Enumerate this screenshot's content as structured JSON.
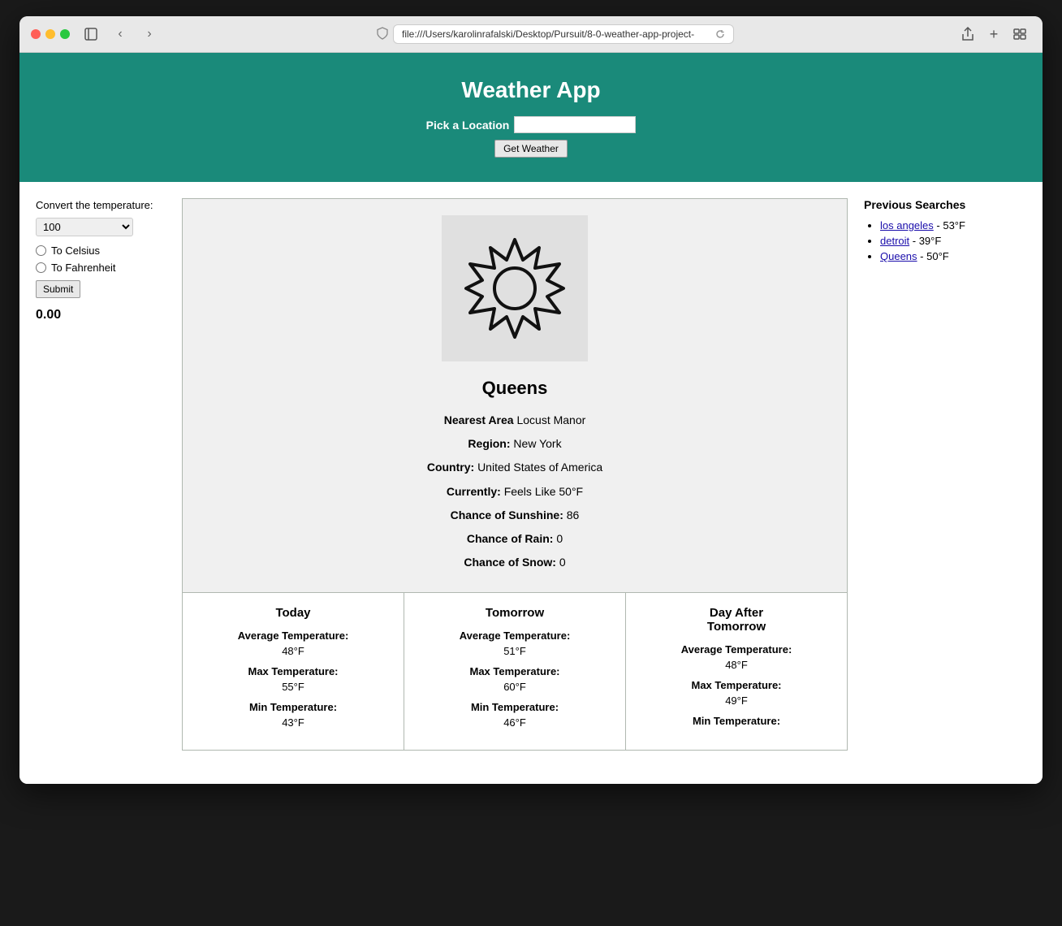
{
  "browser": {
    "address": "file:///Users/karolinrafalski/Desktop/Pursuit/8-0-weather-app-project-",
    "reload_title": "Reload page"
  },
  "app": {
    "title": "Weather App",
    "location_label": "Pick a Location",
    "location_placeholder": "",
    "get_weather_button": "Get Weather"
  },
  "converter": {
    "label": "Convert the temperature:",
    "input_value": "100",
    "to_celsius_label": "To Celsius",
    "to_fahrenheit_label": "To Fahrenheit",
    "submit_label": "Submit",
    "result": "0.00"
  },
  "weather": {
    "city": "Queens",
    "nearest_area_label": "Nearest Area",
    "nearest_area_value": "Locust Manor",
    "region_label": "Region:",
    "region_value": "New York",
    "country_label": "Country:",
    "country_value": "United States of America",
    "currently_label": "Currently:",
    "currently_value": "Feels Like 50°F",
    "sunshine_label": "Chance of Sunshine:",
    "sunshine_value": "86",
    "rain_label": "Chance of Rain:",
    "rain_value": "0",
    "snow_label": "Chance of Snow:",
    "snow_value": "0"
  },
  "forecast": [
    {
      "day": "Today",
      "avg_temp_label": "Average Temperature:",
      "avg_temp": "48°F",
      "max_temp_label": "Max Temperature:",
      "max_temp": "55°F",
      "min_temp_label": "Min Temperature:",
      "min_temp": "43°F"
    },
    {
      "day": "Tomorrow",
      "avg_temp_label": "Average Temperature:",
      "avg_temp": "51°F",
      "max_temp_label": "Max Temperature:",
      "max_temp": "60°F",
      "min_temp_label": "Min Temperature:",
      "min_temp": "46°F"
    },
    {
      "day": "Day After Tomorrow",
      "avg_temp_label": "Average Temperature:",
      "avg_temp": "48°F",
      "max_temp_label": "Max Temperature:",
      "max_temp": "49°F",
      "min_temp_label": "Min Temperature:",
      "min_temp": ""
    }
  ],
  "previous_searches": {
    "title": "Previous Searches",
    "items": [
      {
        "city": "los angeles",
        "temp": "53°F"
      },
      {
        "city": "detroit",
        "temp": "39°F"
      },
      {
        "city": "Queens",
        "temp": "50°F"
      }
    ]
  }
}
